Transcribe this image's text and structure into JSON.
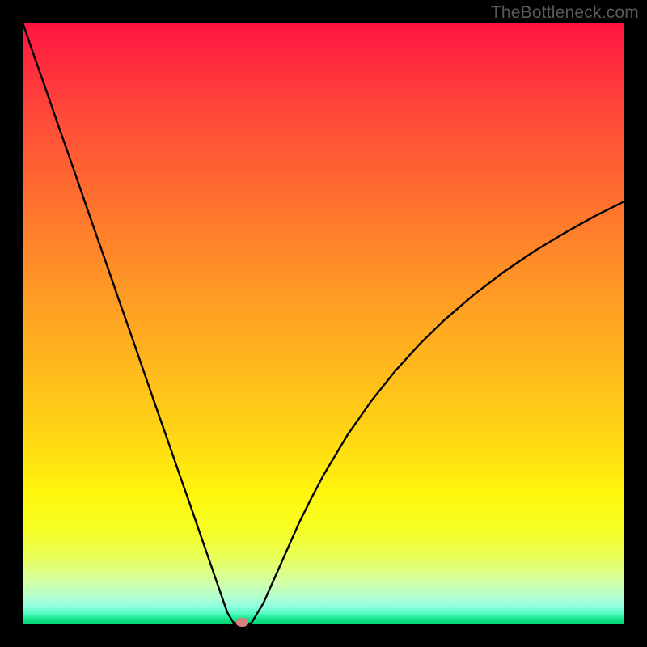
{
  "watermark": "TheBottleneck.com",
  "colors": {
    "frame": "#000000",
    "curve_stroke": "#000000",
    "marker_fill": "#d97f7c",
    "gradient_top": "#ff133f",
    "gradient_bottom": "#00d173"
  },
  "chart_data": {
    "type": "line",
    "title": "",
    "xlabel": "",
    "ylabel": "",
    "xlim": [
      0,
      100
    ],
    "ylim": [
      0,
      100
    ],
    "grid": false,
    "legend": false,
    "annotations": [
      "TheBottleneck.com"
    ],
    "series": [
      {
        "name": "bottleneck_curve",
        "x": [
          0,
          2,
          4,
          6,
          8,
          10,
          12,
          14,
          16,
          18,
          20,
          22,
          24,
          26,
          28,
          30,
          32,
          33,
          34,
          35,
          36,
          37,
          38,
          40,
          42,
          44,
          46,
          48,
          50,
          54,
          58,
          62,
          66,
          70,
          75,
          80,
          85,
          90,
          95,
          100
        ],
        "y": [
          100,
          94.2,
          88.5,
          82.7,
          77.0,
          71.2,
          65.4,
          59.7,
          53.9,
          48.2,
          42.4,
          36.6,
          30.9,
          25.1,
          19.4,
          13.6,
          7.8,
          4.9,
          2.0,
          0.3,
          0.0,
          0.0,
          0.2,
          3.5,
          8.0,
          12.5,
          17.0,
          21.0,
          24.8,
          31.5,
          37.2,
          42.2,
          46.6,
          50.5,
          54.8,
          58.6,
          62.0,
          65.0,
          67.8,
          70.3
        ]
      }
    ],
    "marker": {
      "x": 36.5,
      "y": 0.0
    },
    "notes": "V-shaped curve over a vertical red→yellow→green gradient; minimum near x≈36.5 at y≈0."
  }
}
